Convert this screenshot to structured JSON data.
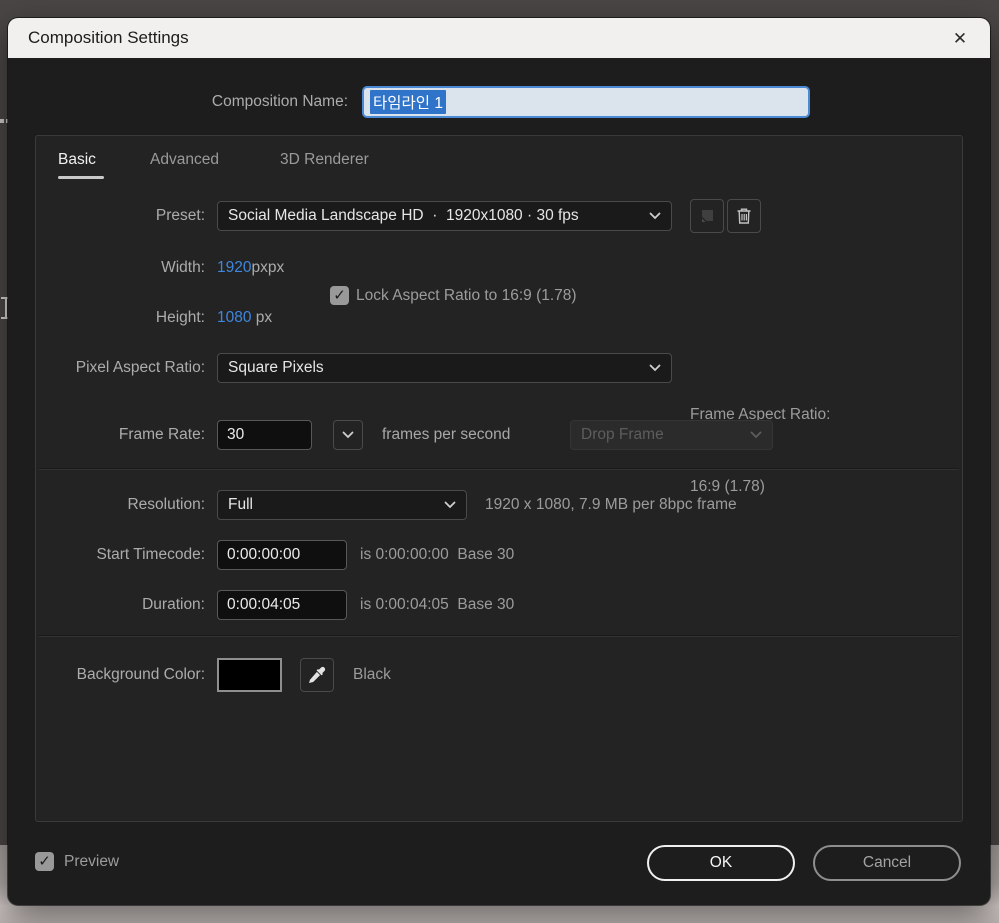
{
  "window": {
    "title": "Composition Settings"
  },
  "icons": {
    "close": "✕",
    "check": "✓"
  },
  "composition_name": {
    "label": "Composition Name:",
    "value": "타임라인 1"
  },
  "tabs": {
    "basic": "Basic",
    "advanced": "Advanced",
    "renderer_3d": "3D Renderer"
  },
  "preset": {
    "label": "Preset:",
    "value": "Social Media Landscape HD  ·  1920x1080 · 30 fps"
  },
  "dimensions": {
    "width_label": "Width:",
    "width_value": "1920",
    "width_unit": "px",
    "height_label": "Height:",
    "height_value": "1080",
    "height_unit": "px",
    "lock_label": "Lock Aspect Ratio to 16:9 (1.78)",
    "lock_checked": true
  },
  "pixel_aspect_ratio": {
    "label": "Pixel Aspect Ratio:",
    "value": "Square Pixels"
  },
  "frame_aspect_ratio": {
    "label_line1": "Frame Aspect Ratio:",
    "label_line2": "16:9 (1.78)"
  },
  "frame_rate": {
    "label": "Frame Rate:",
    "value": "30",
    "suffix": "frames per second",
    "drop_frame": "Drop Frame"
  },
  "resolution": {
    "label": "Resolution:",
    "value": "Full",
    "info": "1920 x 1080, 7.9 MB per 8bpc frame"
  },
  "start_timecode": {
    "label": "Start Timecode:",
    "value": "0:00:00:00",
    "info": "is 0:00:00:00  Base 30"
  },
  "duration": {
    "label": "Duration:",
    "value": "0:00:04:05",
    "info": "is 0:00:04:05  Base 30"
  },
  "background_color": {
    "label": "Background Color:",
    "name": "Black",
    "swatch_color": "#000000"
  },
  "footer": {
    "preview_label": "Preview",
    "preview_checked": true,
    "ok": "OK",
    "cancel": "Cancel"
  },
  "colors": {
    "accent_blue": "#3e87de",
    "selection_blue": "#2f74c9",
    "dialog_bg": "#1d1d1d",
    "panel_bg": "#232323",
    "titlebar_bg": "#f2f0ee"
  }
}
